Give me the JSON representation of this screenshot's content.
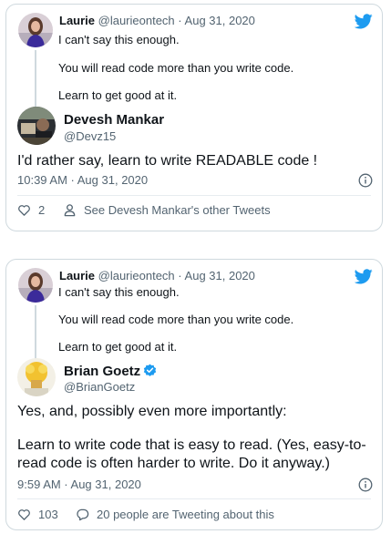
{
  "tweets": [
    {
      "parent": {
        "name": "Laurie",
        "handle": "@laurieontech",
        "sep": "·",
        "date": "Aug 31, 2020",
        "lines": [
          "I can't say this enough.",
          "You will read code more than you write code.",
          "Learn to get good at it."
        ]
      },
      "reply": {
        "name": "Devesh Mankar",
        "handle": "@Devz15",
        "text_lines": [
          "I'd rather say, learn to write READABLE code !"
        ],
        "timestamp": "10:39 AM · Aug 31, 2020"
      },
      "actions": {
        "likes": "2",
        "second": "See Devesh Mankar's other Tweets",
        "second_icon": "person-icon"
      }
    },
    {
      "parent": {
        "name": "Laurie",
        "handle": "@laurieontech",
        "sep": "·",
        "date": "Aug 31, 2020",
        "lines": [
          "I can't say this enough.",
          "You will read code more than you write code.",
          "Learn to get good at it."
        ]
      },
      "reply": {
        "name": "Brian Goetz",
        "handle": "@BrianGoetz",
        "verified": true,
        "text_lines": [
          "Yes, and, possibly even more importantly:",
          "",
          "Learn to write code that is easy to read.  (Yes, easy-to-",
          "read code is often harder to write.  Do it anyway.)"
        ],
        "timestamp": "9:59 AM · Aug 31, 2020"
      },
      "actions": {
        "likes": "103",
        "second": "20 people are Tweeting about this",
        "second_icon": "reply-bubble-icon"
      }
    }
  ],
  "colors": {
    "text": "#0f1419",
    "secondary": "#536471",
    "twitter_blue": "#1d9bf0",
    "border": "#cfd9de"
  }
}
